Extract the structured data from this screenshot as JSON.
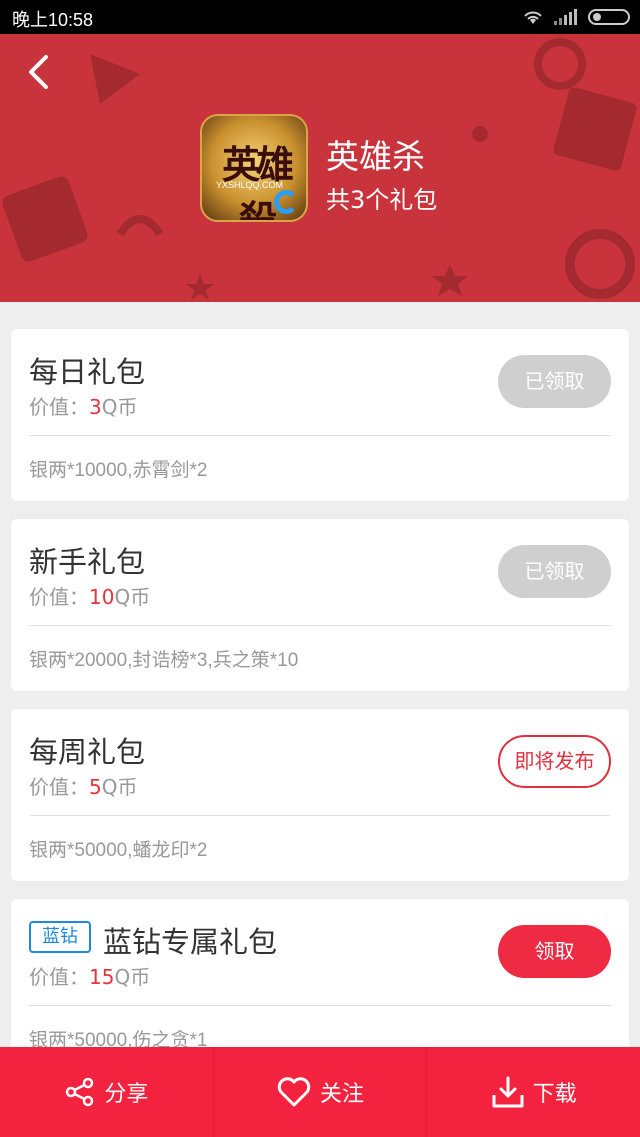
{
  "status_bar": {
    "time": "晚上10:58"
  },
  "header": {
    "game_name": "英雄杀",
    "gift_count": "共3个礼包",
    "icon_text": "英雄殺",
    "icon_small_text": "YXSHLQQ.COM"
  },
  "gifts": [
    {
      "title": "每日礼包",
      "value_prefix": "价值：",
      "value_num": "3",
      "value_unit": "Q币",
      "content": "银两*10000,赤霄剑*2",
      "button": "已领取"
    },
    {
      "title": "新手礼包",
      "value_prefix": "价值：",
      "value_num": "10",
      "value_unit": "Q币",
      "content": "银两*20000,封诰榜*3,兵之策*10",
      "button": "已领取"
    },
    {
      "title": "每周礼包",
      "value_prefix": "价值：",
      "value_num": "5",
      "value_unit": "Q币",
      "content": "银两*50000,蟠龙印*2",
      "button": "即将发布"
    },
    {
      "badge": "蓝钻",
      "title": "蓝钻专属礼包",
      "value_prefix": "价值：",
      "value_num": "15",
      "value_unit": "Q币",
      "content": "银两*50000,伤之贪*1",
      "button": "领取"
    }
  ],
  "bottom_bar": {
    "share": "分享",
    "follow": "关注",
    "download": "下载"
  },
  "colors": {
    "header_bg": "#c9343c",
    "accent_red": "#ef2a43",
    "badge_blue": "#1e88e5"
  }
}
